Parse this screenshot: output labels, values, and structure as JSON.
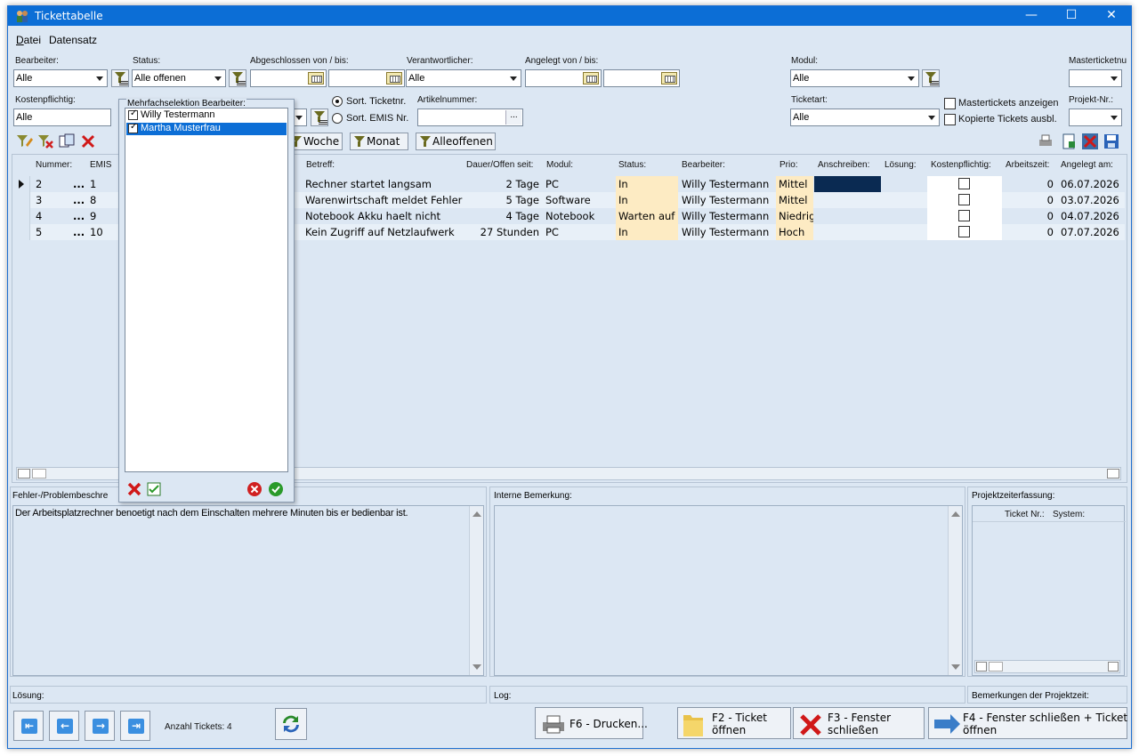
{
  "window": {
    "title": "Tickettabelle",
    "minimize": "—",
    "maximize": "☐",
    "close": "✕"
  },
  "menu": {
    "file": "Datei",
    "file_underline": "D",
    "file_rest": "atei",
    "record": "Datensatz"
  },
  "filters": {
    "bearbeiter_label": "Bearbeiter:",
    "bearbeiter_value": "Alle",
    "status_label": "Status:",
    "status_value": "Alle offenen",
    "abgeschlossen_label": "Abgeschlossen von / bis:",
    "verantwortlicher_label": "Verantwortlicher:",
    "verantwortlicher_value": "Alle",
    "angelegt_label": "Angelegt von / bis:",
    "modul_label": "Modul:",
    "modul_value": "Alle",
    "masterticket_label": "Masterticketnu",
    "kosten_label": "Kostenpflichtig:",
    "kosten_value": "Alle",
    "sort_ticket": "Sort. Ticketnr.",
    "sort_emis": "Sort. EMIS Nr.",
    "artikel_label": "Artikelnummer:",
    "artikel_btn": "...",
    "ticketart_label": "Ticketart:",
    "ticketart_value": "Alle",
    "master_anzeigen": "Mastertickets anzeigen",
    "kopierte_ausbl": "Kopierte Tickets ausbl.",
    "projekt_label": "Projekt-Nr.:"
  },
  "toolbar": {
    "woche": "Woche",
    "monat": "Monat",
    "alleoffenen": "Alleoffenen"
  },
  "table": {
    "headers": {
      "nummer": "Nummer:",
      "emis": "EMIS",
      "betreff": "Betreff:",
      "dauer": "Dauer/Offen seit:",
      "modul": "Modul:",
      "status": "Status:",
      "bearbeiter": "Bearbeiter:",
      "prio": "Prio:",
      "anschreiben": "Anschreiben:",
      "loesung": "Lösung:",
      "kosten": "Kostenpflichtig:",
      "arbeitszeit": "Arbeitszeit:",
      "angelegt": "Angelegt am:"
    },
    "rows": [
      {
        "nummer": "2",
        "dots": "...",
        "emis": "1",
        "betreff": "Rechner startet langsam",
        "dauer": "2 Tage",
        "modul": "PC",
        "status": "In",
        "bearbeiter": "Willy Testermann",
        "prio": "Mittel",
        "arbeitszeit": "0",
        "angelegt": "06.07.2026"
      },
      {
        "nummer": "3",
        "dots": "...",
        "emis": "8",
        "betreff": "Warenwirtschaft meldet Fehler",
        "dauer": "5 Tage",
        "modul": "Software",
        "status": "In",
        "bearbeiter": "Willy Testermann",
        "prio": "Mittel",
        "arbeitszeit": "0",
        "angelegt": "03.07.2026"
      },
      {
        "nummer": "4",
        "dots": "...",
        "emis": "9",
        "betreff": "Notebook Akku haelt nicht",
        "dauer": "4 Tage",
        "modul": "Notebook",
        "status": "Warten auf",
        "bearbeiter": "Willy Testermann",
        "prio": "Niedrig",
        "arbeitszeit": "0",
        "angelegt": "04.07.2026"
      },
      {
        "nummer": "5",
        "dots": "...",
        "emis": "10",
        "betreff": "Kein Zugriff auf Netzlaufwerk",
        "dauer": "27 Stunden",
        "modul": "PC",
        "status": "In",
        "bearbeiter": "Willy Testermann",
        "prio": "Hoch",
        "arbeitszeit": "0",
        "angelegt": "07.07.2026"
      }
    ]
  },
  "popup": {
    "title": "Mehrfachselektion Bearbeiter:",
    "items": [
      {
        "name": "Willy Testermann"
      },
      {
        "name": "Martha Musterfrau"
      }
    ]
  },
  "panels": {
    "fehler_label": "Fehler-/Problembeschre",
    "fehler_text": "Der Arbeitsplatzrechner benoetigt nach dem Einschalten mehrere Minuten bis er bedienbar ist.",
    "intern_label": "Interne Bemerkung:",
    "projekt_label": "Projektzeiterfassung:",
    "projekt_col_ticket": "Ticket Nr.:",
    "projekt_col_system": "System:",
    "loesung_label": "Lösung:",
    "log_label": "Log:",
    "bemerkungen_label": "Bemerkungen der Projektzeit:"
  },
  "footer": {
    "anzahl": "Anzahl Tickets: 4",
    "drucken": "F6 - Drucken...",
    "ticket_oeffnen": "F2 - Ticket\nöffnen",
    "fenster_schliessen": "F3 - Fenster\nschließen",
    "fenster_ticket": "F4 - Fenster schließen + Ticket\nöffnen"
  },
  "colors": {
    "titlebar": "#0c6ed6",
    "selected": "#0c6ed6",
    "status_bg": "#fdebc3",
    "prio_bg": "#fdebc3",
    "anschreiben_dark": "#0a2a52"
  }
}
